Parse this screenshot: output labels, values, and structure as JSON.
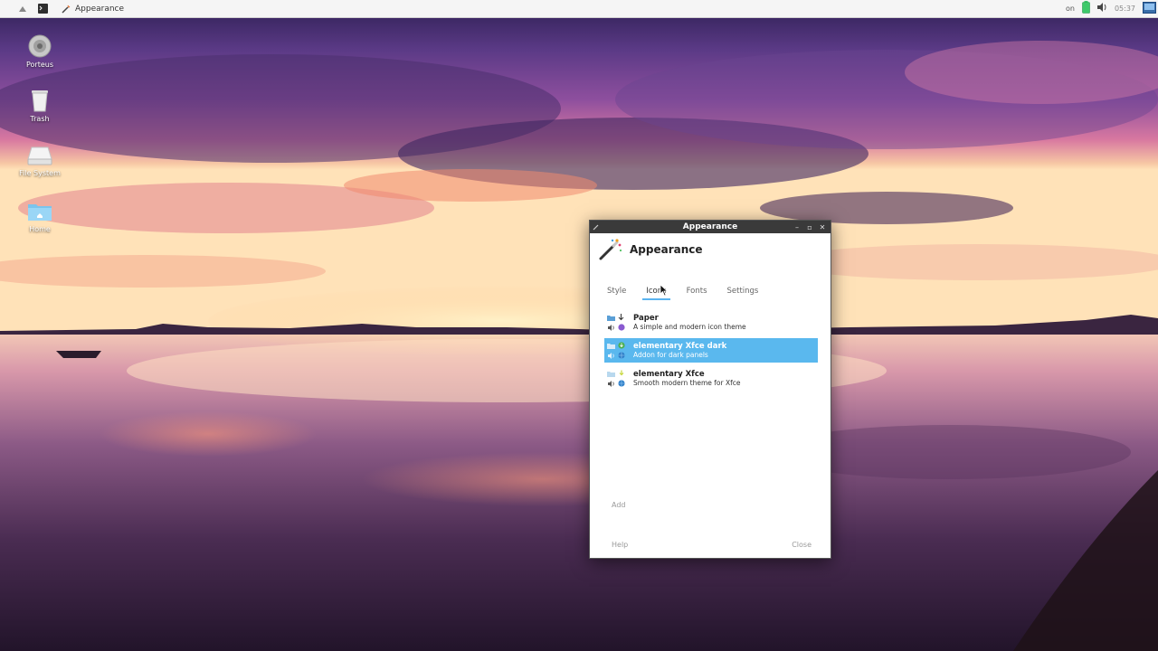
{
  "panel": {
    "task_label": "Appearance",
    "network_label": "on",
    "clock": "05:37"
  },
  "desktop": {
    "icons": [
      {
        "label": "Porteus",
        "icon": "disc-icon"
      },
      {
        "label": "Trash",
        "icon": "trash-icon"
      },
      {
        "label": "File System",
        "icon": "drive-icon"
      },
      {
        "label": "Home",
        "icon": "home-folder-icon"
      }
    ]
  },
  "dialog": {
    "window_title": "Appearance",
    "heading": "Appearance",
    "tabs": [
      {
        "label": "Style",
        "active": false
      },
      {
        "label": "Icons",
        "active": true
      },
      {
        "label": "Fonts",
        "active": false
      },
      {
        "label": "Settings",
        "active": false
      }
    ],
    "themes": [
      {
        "name": "Paper",
        "description": "A simple and modern icon theme",
        "selected": false
      },
      {
        "name": "elementary Xfce dark",
        "description": "Addon for dark panels",
        "selected": true
      },
      {
        "name": "elementary Xfce",
        "description": "Smooth modern theme for Xfce",
        "selected": false
      }
    ],
    "add_label": "Add",
    "help_label": "Help",
    "close_label": "Close"
  },
  "colors": {
    "selection": "#5ab8ee",
    "titlebar": "#3a3a3a",
    "panel_bg": "#f5f5f5",
    "battery": "#3ec96a"
  }
}
